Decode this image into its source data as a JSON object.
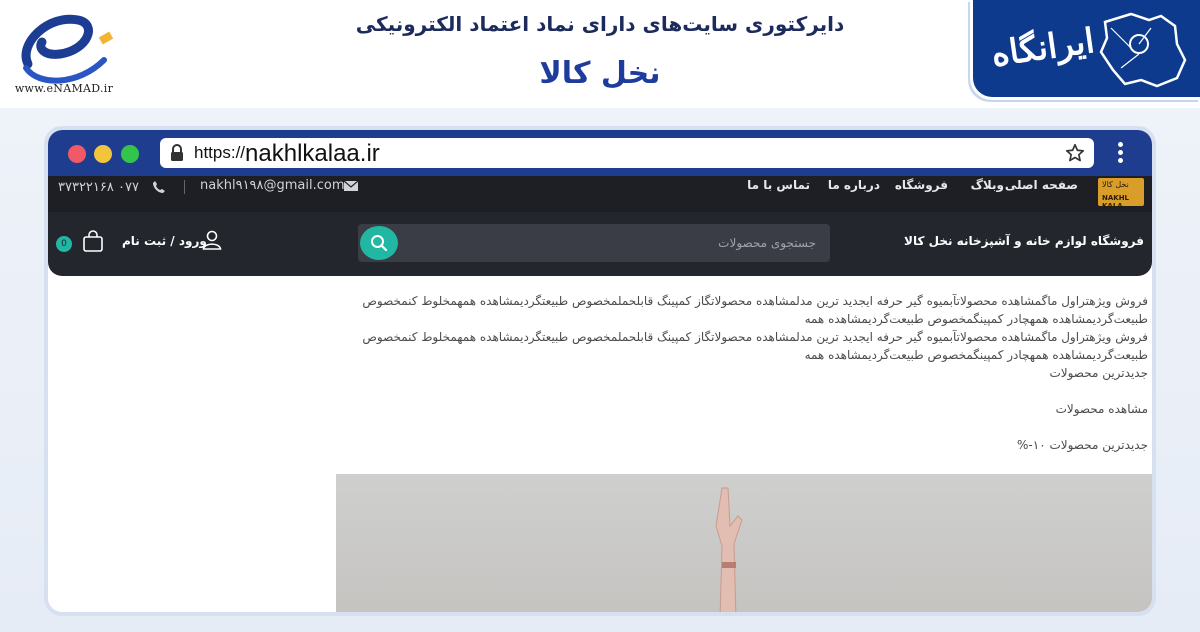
{
  "banner": {
    "enamad_caption": "www.eNAMAD.ir",
    "directory_title": "دایرکتوری سایت‌های دارای نماد اعتماد الکترونیکی",
    "site_name": "نخل کالا",
    "irangah_text": "ایرانگاه"
  },
  "browser": {
    "url_protocol": "https://",
    "url_domain": "nakhlkalaa.ir"
  },
  "site_top": {
    "phone": "۰۷۷ ۳۷۳۲۲۱۶۸",
    "email": "nakhl۹۱۹۸@gmail.com",
    "nav": [
      "صفحه اصلی",
      "وبلاگ",
      "فروشگاه",
      "درباره ما",
      "تماس با ما"
    ],
    "logo_line1": "نخل کالا",
    "logo_line2": "NAKHL KALA"
  },
  "site_main": {
    "store_title": "فروشگاه لوازم خانه و آشپزخانه نخل کالا",
    "search_placeholder": "جستجوی محصولات",
    "login_label": "ورود / ثبت نام",
    "cart_count": "0"
  },
  "content": {
    "line1": "فروش ویژهتراول ماگمشاهده محصولاتآبمیوه گیر حرفه ایجدید ترین مدلمشاهده محصولاتگاز کمپینگ قابلحملمخصوص طبیعتگردیمشاهده همهمخلوط کنمخصوص",
    "line2": "طبیعت‌گردیمشاهده همهچادر کمپینگمخصوص طبیعت‌گردیمشاهده همه",
    "line3": "فروش ویژهتراول ماگمشاهده محصولاتآبمیوه گیر حرفه ایجدید ترین مدلمشاهده محصولاتگاز کمپینگ قابلحملمخصوص طبیعتگردیمشاهده همهمخلوط کنمخصوص",
    "line4": "طبیعت‌گردیمشاهده همهچادر کمپینگمخصوص طبیعت‌گردیمشاهده همه",
    "line5": "جدیدترین محصولات",
    "line6": "مشاهده محصولات",
    "line7": "جدیدترین محصولات ۱۰-%"
  },
  "colors": {
    "chrome_blue": "#1f3d8f",
    "accent_teal": "#21b7a3",
    "site_dark": "#24262d",
    "title_blue": "#1e3c9c"
  },
  "icons": [
    "enamad-logo-icon",
    "irangah-map-icon",
    "lock-icon",
    "star-icon",
    "kebab-menu-icon",
    "phone-icon",
    "mail-icon",
    "search-icon",
    "user-icon",
    "cart-icon"
  ]
}
